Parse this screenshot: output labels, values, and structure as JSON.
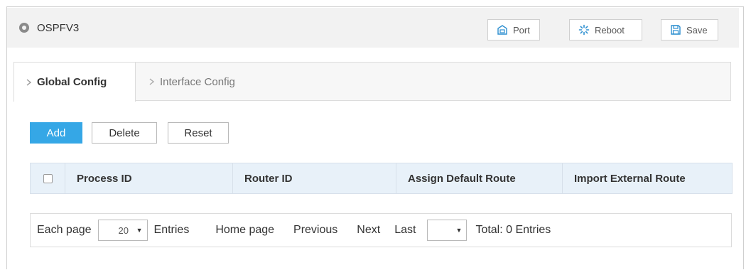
{
  "header": {
    "title": "OSPFV3",
    "buttons": {
      "port": "Port",
      "reboot": "Reboot",
      "save": "Save"
    }
  },
  "tabs": [
    {
      "label": "Global Config",
      "active": true
    },
    {
      "label": "Interface Config",
      "active": false
    }
  ],
  "actions": {
    "add": "Add",
    "delete": "Delete",
    "reset": "Reset"
  },
  "table": {
    "columns": [
      "Process ID",
      "Router ID",
      "Assign Default Route",
      "Import External Route"
    ],
    "rows": []
  },
  "pager": {
    "each_page": "Each page",
    "page_size": "20",
    "entries": "Entries",
    "home": "Home page",
    "previous": "Previous",
    "next": "Next",
    "last": "Last",
    "page_select": "",
    "total": "Total: 0 Entries"
  },
  "colors": {
    "primary": "#35a7e6",
    "header_bg": "#f2f2f2",
    "table_header_bg": "#e8f1f9"
  }
}
